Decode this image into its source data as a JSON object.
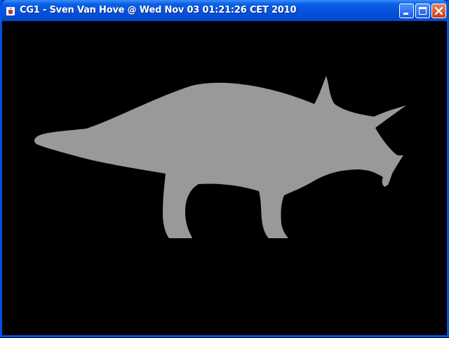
{
  "window": {
    "title": "CG1 - Sven Van Hove @ Wed Nov 03 01:21:26 CET 2010",
    "title_icon": "java-cup-icon",
    "controls": [
      "minimize-icon",
      "maximize-icon",
      "close-icon"
    ]
  },
  "canvas": {
    "background": "#000000",
    "shape": "triceratops-silhouette",
    "shape_color": "#999999"
  },
  "colors": {
    "titlebar": "#0553dc",
    "close_button": "#d2532e"
  }
}
